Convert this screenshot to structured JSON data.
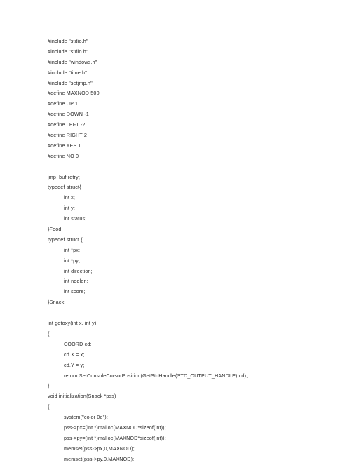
{
  "document": {
    "type": "source-code-listing",
    "language": "C",
    "background_color": "#ffffff",
    "text_color": "#2b2b2b",
    "lines": [
      {
        "text": "#include \"stdio.h\"",
        "indent": 0
      },
      {
        "text": "#include \"stdio.h\"",
        "indent": 0
      },
      {
        "text": "#include \"windows.h\"",
        "indent": 0
      },
      {
        "text": "#include \"time.h\"",
        "indent": 0
      },
      {
        "text": "#include \"setjmp.h\"",
        "indent": 0
      },
      {
        "text": "#define MAXNOD 500",
        "indent": 0
      },
      {
        "text": "#define UP 1",
        "indent": 0
      },
      {
        "text": "#define DOWN -1",
        "indent": 0
      },
      {
        "text": "#define LEFT -2",
        "indent": 0
      },
      {
        "text": "#define RIGHT 2",
        "indent": 0
      },
      {
        "text": "#define YES 1",
        "indent": 0
      },
      {
        "text": "#define NO 0",
        "indent": 0
      },
      {
        "text": "",
        "indent": 0
      },
      {
        "text": "jmp_buf retry;",
        "indent": 0
      },
      {
        "text": "typedef struct{",
        "indent": 0
      },
      {
        "text": "int x;",
        "indent": 1
      },
      {
        "text": "int y;",
        "indent": 1
      },
      {
        "text": "int status;",
        "indent": 1
      },
      {
        "text": "}Food;",
        "indent": 0
      },
      {
        "text": "typedef struct {",
        "indent": 0
      },
      {
        "text": "int *px;",
        "indent": 1
      },
      {
        "text": "int *py;",
        "indent": 1
      },
      {
        "text": "int direction;",
        "indent": 1
      },
      {
        "text": "int nodlen;",
        "indent": 1
      },
      {
        "text": "int score;",
        "indent": 1
      },
      {
        "text": "}Snack;",
        "indent": 0
      },
      {
        "text": "",
        "indent": 0
      },
      {
        "text": "int gotoxy(int x, int y)",
        "indent": 0
      },
      {
        "text": "{",
        "indent": 0
      },
      {
        "text": "COORD cd;",
        "indent": 1
      },
      {
        "text": "cd.X = x;",
        "indent": 1
      },
      {
        "text": "cd.Y = y;",
        "indent": 1
      },
      {
        "text": "return SetConsoleCursorPosition(GetStdHandle(STD_OUTPUT_HANDLE),cd);",
        "indent": 1
      },
      {
        "text": "}",
        "indent": 0
      },
      {
        "text": "void initialization(Snack *pss)",
        "indent": 0
      },
      {
        "text": "{",
        "indent": 0
      },
      {
        "text": "system(\"color 0e\");",
        "indent": 1
      },
      {
        "text": "pss->px=(int *)malloc(MAXNOD*sizeof(int));",
        "indent": 1
      },
      {
        "text": "pss->py=(int *)malloc(MAXNOD*sizeof(int));",
        "indent": 1
      },
      {
        "text": "memset(pss->px,0,MAXNOD);",
        "indent": 1
      },
      {
        "text": "memset(pss->py,0,MAXNOD);",
        "indent": 1
      }
    ]
  }
}
